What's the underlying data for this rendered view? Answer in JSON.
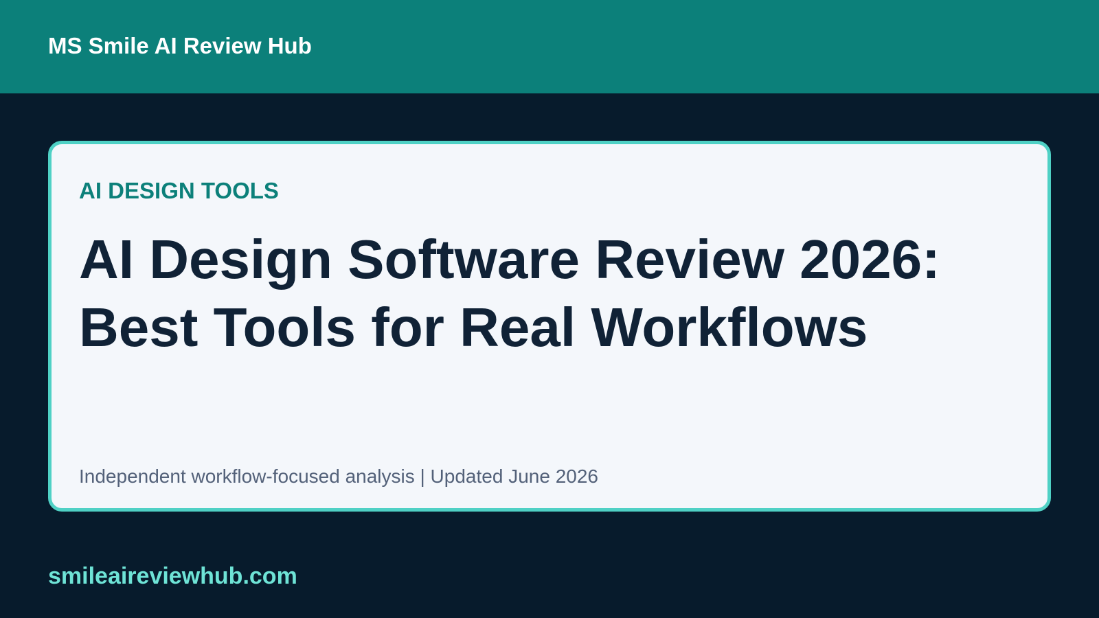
{
  "header": {
    "brand_title": "MS Smile AI Review Hub"
  },
  "article_card": {
    "category": "AI DESIGN TOOLS",
    "headline_line_1": "AI Design Software Review 2026:",
    "headline_line_2": "Best Tools for Real Workflows",
    "meta": "Independent workflow-focused analysis | Updated June 2026"
  },
  "footer": {
    "site_url": "smileaireviewhub.com"
  },
  "colors": {
    "header_background": "#0c807a",
    "page_background": "#071b2c",
    "card_background": "#f4f7fb",
    "card_border": "#4fd1c5",
    "category_text": "#0c807a",
    "headline_text": "#102236",
    "meta_text": "#536179",
    "site_url_text": "#6ee3d6"
  }
}
